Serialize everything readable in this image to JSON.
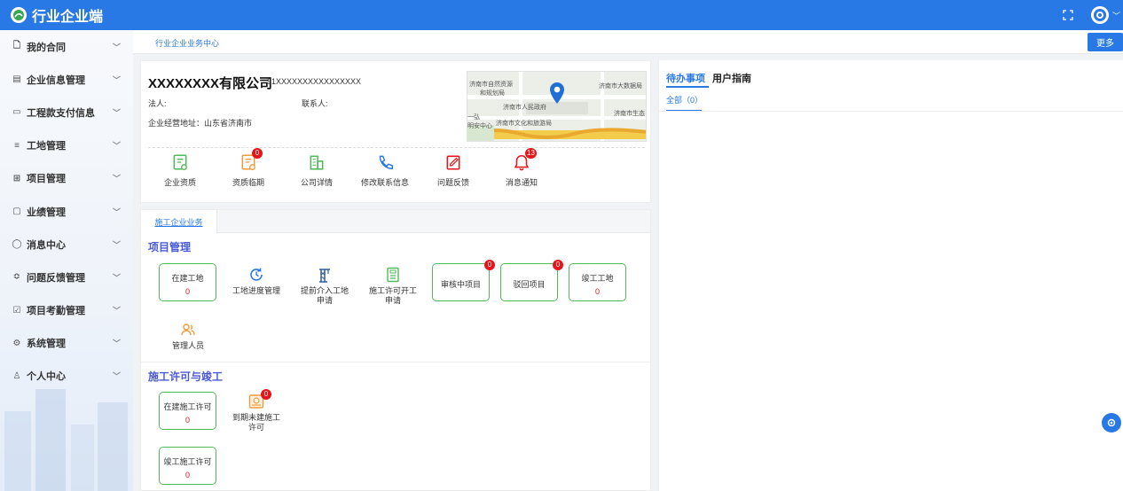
{
  "app": {
    "title": "行业企业端"
  },
  "sidebar": {
    "items": [
      {
        "label": "我的合同",
        "icon": "document-icon"
      },
      {
        "label": "企业信息管理",
        "icon": "id-card-icon"
      },
      {
        "label": "工程款支付信息",
        "icon": "monitor-icon"
      },
      {
        "label": "工地管理",
        "icon": "list-icon"
      },
      {
        "label": "项目管理",
        "icon": "grid-icon"
      },
      {
        "label": "业绩管理",
        "icon": "folder-icon"
      },
      {
        "label": "消息中心",
        "icon": "location-icon"
      },
      {
        "label": "问题反馈管理",
        "icon": "chat-icon"
      },
      {
        "label": "项目考勤管理",
        "icon": "checklist-icon"
      },
      {
        "label": "系统管理",
        "icon": "gear-icon"
      },
      {
        "label": "个人中心",
        "icon": "user-icon"
      }
    ]
  },
  "breadcrumb": {
    "tab": "行业企业业务中心",
    "more": "更多"
  },
  "company": {
    "name": "XXXXXXXX有限公司",
    "credit_code": "91XXXXXXXXXXXXXXXX",
    "legal_person": "法人:",
    "contact": "联系人:",
    "address": "企业经营地址：山东省济南市",
    "map_labels": [
      "济南市自然资源",
      "和规划局",
      "济南市大数据局",
      "济南市人民政府",
      "济南市生态",
      "济南市文化和旅游局",
      "一弘",
      "明安中心"
    ]
  },
  "quick_links": [
    {
      "label": "企业资质",
      "icon": "certificate-icon",
      "badge": ""
    },
    {
      "label": "资质临期",
      "icon": "expiring-certificate-icon",
      "badge": "0"
    },
    {
      "label": "公司详情",
      "icon": "building-icon",
      "badge": ""
    },
    {
      "label": "修改联系信息",
      "icon": "phone-icon",
      "badge": ""
    },
    {
      "label": "问题反馈",
      "icon": "edit-icon",
      "badge": ""
    },
    {
      "label": "消息通知",
      "icon": "bell-icon",
      "badge": "13"
    }
  ],
  "business": {
    "tab": "施工企业业务",
    "project_section": {
      "title": "项目管理",
      "items": [
        {
          "label": "在建工地",
          "value": "0"
        },
        {
          "label": "工地进度管理"
        },
        {
          "label": "提前介入工地申请"
        },
        {
          "label": "施工许可开工申请"
        },
        {
          "label": "审核中项目",
          "badge": "0"
        },
        {
          "label": "驳回项目",
          "badge": "0"
        },
        {
          "label": "竣工工地",
          "value": "0"
        },
        {
          "label": "管理人员"
        }
      ]
    },
    "permit_section": {
      "title": "施工许可与竣工",
      "items": [
        {
          "label": "在建施工许可",
          "value": "0"
        },
        {
          "label": "到期未建施工许可",
          "badge": "0"
        },
        {
          "label": "竣工施工许可",
          "value": "0"
        }
      ]
    }
  },
  "todo": {
    "tab_active": "待办事项",
    "tab_other": "用户指南",
    "filter": "全部（0）"
  },
  "colors": {
    "primary": "#2878e6",
    "green": "#52b95b",
    "red": "#e4161c",
    "section": "#4a5ad8"
  }
}
